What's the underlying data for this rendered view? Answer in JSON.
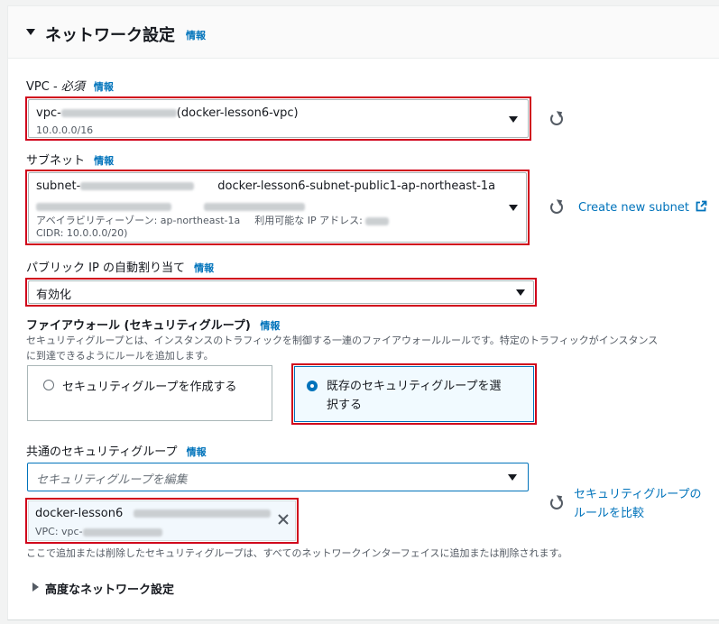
{
  "section": {
    "title": "ネットワーク設定",
    "info": "情報"
  },
  "vpc": {
    "label_prefix": "VPC - ",
    "label_required": "必須",
    "info": "情報",
    "value_prefix": "vpc-",
    "value_name": "(docker-lesson6-vpc)",
    "cidr": "10.0.0.0/16"
  },
  "subnet": {
    "label": "サブネット",
    "info": "情報",
    "value_prefix": "subnet-",
    "value_name": "docker-lesson6-subnet-public1-ap-northeast-1a",
    "az_text": "アベイラビリティーゾーン: ap-northeast-1a",
    "ip_text": "利用可能な IP アドレス:",
    "cidr_text": "CIDR: 10.0.0.0/20)",
    "create_link": "Create new subnet"
  },
  "public_ip": {
    "label": "パブリック IP の自動割り当て",
    "info": "情報",
    "value": "有効化"
  },
  "firewall": {
    "label": "ファイアウォール (セキュリティグループ)",
    "info": "情報",
    "desc_line1": "セキュリティグループとは、インスタンスのトラフィックを制御する一連のファイアウォールルールです。特定のトラフィックがインスタンス",
    "desc_line2": "に到達できるようにルールを追加します。",
    "option_create": "セキュリティグループを作成する",
    "option_existing_line1": "既存のセキュリティグループを選",
    "option_existing_line2": "択する"
  },
  "common_sg": {
    "label": "共通のセキュリティグループ",
    "info": "情報",
    "placeholder": "セキュリティグループを編集",
    "token_name": "docker-lesson6",
    "token_vpc_prefix": "VPC: vpc-",
    "compare_line1": "セキュリティグループの",
    "compare_line2": "ルールを比較",
    "note": "ここで追加または削除したセキュリティグループは、すべてのネットワークインターフェイスに追加または削除されます。"
  },
  "advanced": {
    "label": "高度なネットワーク設定"
  },
  "icons": [
    "caret-down-icon",
    "refresh-icon",
    "external-link-icon",
    "close-icon",
    "caret-right-icon"
  ],
  "colors": {
    "link": "#0073bb",
    "highlight_border": "#d0021b",
    "selected_bg": "#f1faff"
  }
}
